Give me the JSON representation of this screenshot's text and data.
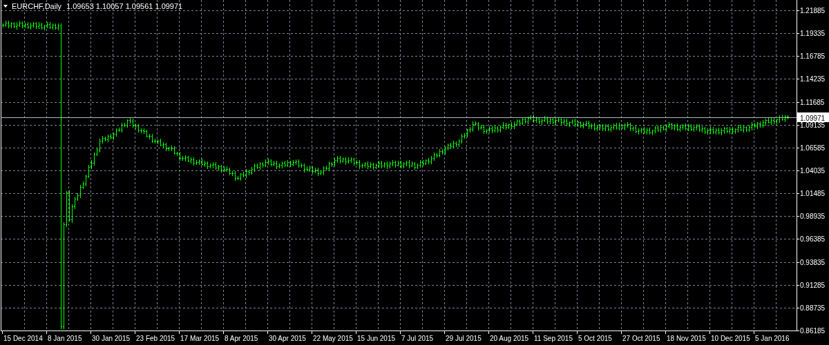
{
  "chart_header": {
    "symbol": "EURCHF,Daily",
    "ohlc": "1.09653 1.10057 1.09561 1.09971"
  },
  "price_line": {
    "label": "1.09971"
  },
  "price_axis": {
    "labels": [
      "1.21885",
      "1.19335",
      "1.16785",
      "1.14235",
      "1.11685",
      "1.09135",
      "1.06585",
      "1.04035",
      "1.01485",
      "0.98935",
      "0.96385",
      "0.93835",
      "0.91285",
      "0.88735",
      "0.86185"
    ]
  },
  "time_axis": {
    "labels": [
      "15 Dec 2014",
      "8 Jan 2015",
      "30 Jan 2015",
      "23 Feb 2015",
      "17 Mar 2015",
      "8 Apr 2015",
      "30 Apr 2015",
      "22 May 2015",
      "15 Jun 2015",
      "7 Jul 2015",
      "29 Jul 2015",
      "20 Aug 2015",
      "11 Sep 2015",
      "5 Oct 2015",
      "27 Oct 2015",
      "18 Nov 2015",
      "10 Dec 2015",
      "5 Jan 2016"
    ]
  }
}
